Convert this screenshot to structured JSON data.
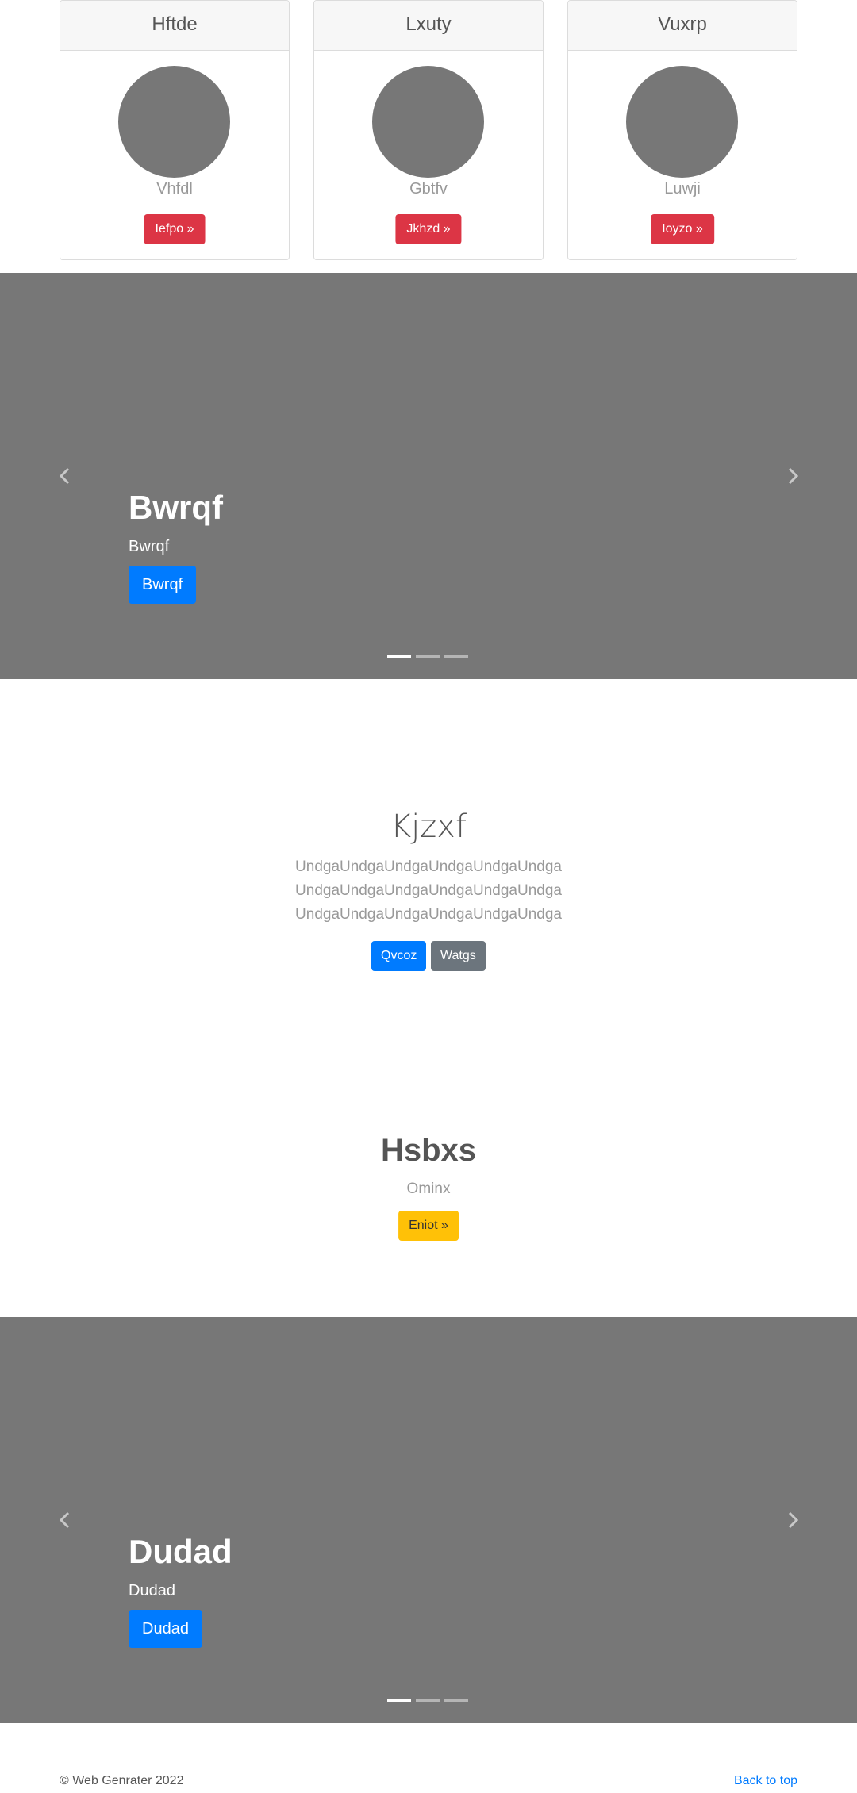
{
  "cards": [
    {
      "title": "Hftde",
      "name": "Vhfdl",
      "button": "Iefpo »"
    },
    {
      "title": "Lxuty",
      "name": "Gbtfv",
      "button": "Jkhzd »"
    },
    {
      "title": "Vuxrp",
      "name": "Luwji",
      "button": "Ioyzo »"
    }
  ],
  "carousel1": {
    "heading": "Bwrqf",
    "text": "Bwrqf",
    "button": "Bwrqf"
  },
  "intro": {
    "heading": "Kjzxf",
    "lines": [
      "UndgaUndgaUndgaUndgaUndgaUndga",
      "UndgaUndgaUndgaUndgaUndgaUndga",
      "UndgaUndgaUndgaUndgaUndgaUndga"
    ],
    "primary_button": "Qvcoz",
    "secondary_button": "Watgs"
  },
  "feature": {
    "heading": "Hsbxs",
    "text": "Ominx",
    "button": "Eniot »"
  },
  "carousel2": {
    "heading": "Dudad",
    "text": "Dudad",
    "button": "Dudad"
  },
  "footer": {
    "copyright": "© Web Genrater 2022",
    "back_to_top": "Back to top"
  },
  "colors": {
    "danger": "#dc3545",
    "primary": "#007bff",
    "secondary": "#6c757d",
    "warning": "#ffc107",
    "carousel_bg": "#777777"
  },
  "icons": {
    "prev": "chevron-left-icon",
    "next": "chevron-right-icon"
  }
}
